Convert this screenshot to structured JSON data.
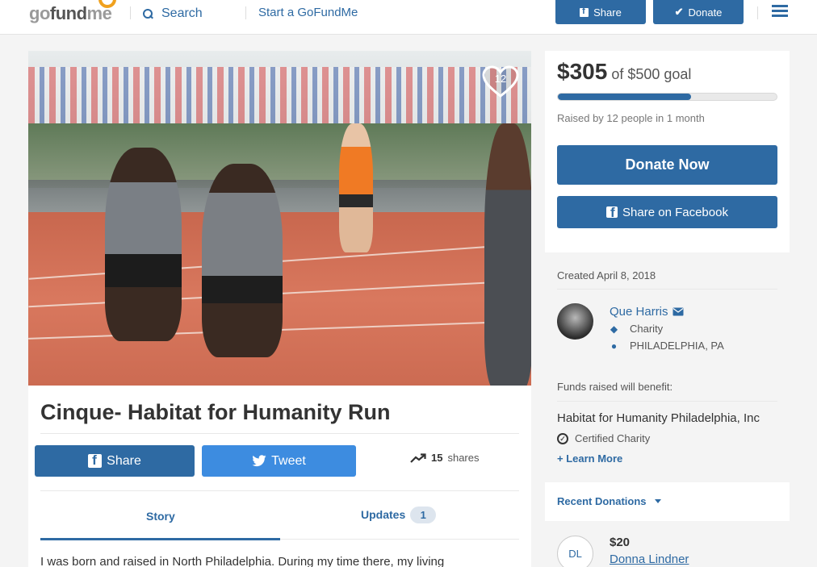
{
  "header": {
    "logo_text": "gofundme",
    "search_label": "Search",
    "start_link": "Start a GoFundMe",
    "share_label": "Share",
    "donate_label": "Donate"
  },
  "hero": {
    "heart_count": "12"
  },
  "campaign": {
    "title": "Cinque- Habitat for Humanity Run",
    "share_label": "Share",
    "tweet_label": "Tweet",
    "shares_count": "15",
    "shares_word": "shares",
    "tabs": [
      {
        "label": "Story"
      },
      {
        "label": "Updates",
        "badge": "1"
      }
    ],
    "story_preview": "I was born and raised in North Philadelphia. During my time there, my living"
  },
  "donate_panel": {
    "raised": "$305",
    "goal_text": "of $500 goal",
    "progress_fraction": 0.61,
    "raised_by": "Raised by 12 people in 1 month",
    "donate_now": "Donate Now",
    "share_facebook": "Share on Facebook"
  },
  "organizer": {
    "created": "Created April 8, 2018",
    "name": "Que Harris",
    "category": "Charity",
    "location": "PHILADELPHIA, PA",
    "benefit_label": "Funds raised will benefit:",
    "beneficiary": "Habitat for Humanity Philadelphia, Inc",
    "certified": "Certified Charity",
    "learn_more": "+ Learn More"
  },
  "recent_donations": {
    "title": "Recent Donations",
    "items": [
      {
        "initials": "DL",
        "amount": "$20",
        "name": "Donna Lindner"
      }
    ]
  },
  "colors": {
    "accent": "#2e6aa3",
    "twitter": "#3d8ce0",
    "logo_sun": "#f0a11e",
    "page_bg": "#f4f4f4"
  },
  "icons": [
    "search-icon",
    "facebook-icon",
    "check-icon",
    "hamburger-icon",
    "heart-icon",
    "twitter-icon",
    "trending-icon",
    "envelope-icon",
    "tag-icon",
    "map-pin-icon",
    "circle-check-icon",
    "caret-down-icon"
  ]
}
